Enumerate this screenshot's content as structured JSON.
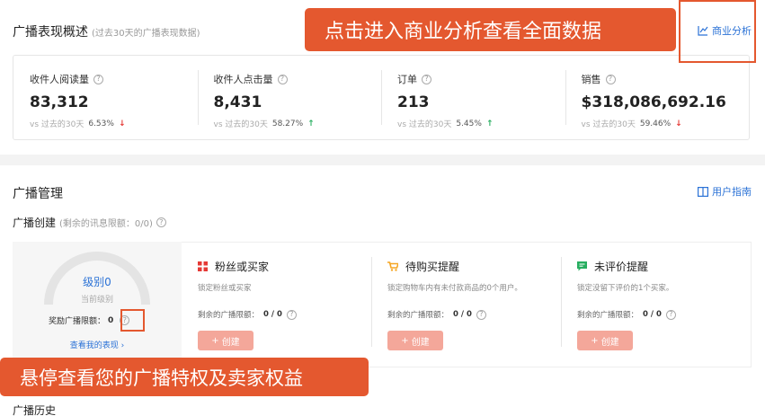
{
  "overview": {
    "title": "广播表现概述",
    "subtitle": "(过去30天的广播表现数据)",
    "business_link": "商业分析",
    "metrics": [
      {
        "label": "收件人阅读量",
        "value": "83,312",
        "compare": "vs 过去的30天",
        "pct": "6.53%",
        "trend": "↓"
      },
      {
        "label": "收件人点击量",
        "value": "8,431",
        "compare": "vs 过去的30天",
        "pct": "58.27%",
        "trend": "↑"
      },
      {
        "label": "订单",
        "value": "213",
        "compare": "vs 过去的30天",
        "pct": "5.45%",
        "trend": "↑"
      },
      {
        "label": "销售",
        "value": "$318,086,692.16",
        "compare": "vs 过去的30天",
        "pct": "59.46%",
        "trend": "↓"
      }
    ]
  },
  "callouts": {
    "top": "点击进入商业分析查看全面数据",
    "bottom": "悬停查看您的广播特权及卖家权益"
  },
  "management": {
    "title": "广播管理",
    "guide_link": "用户指南",
    "create_title": "广播创建",
    "create_sub": "(剩余的讯息限额：0/0)",
    "level": {
      "level_text": "级别0",
      "current_level": "当前级别",
      "reward_label": "奖励广播限额：",
      "reward_value": "0",
      "view_link": "查看我的表现 ›",
      "gauge_fraction": 0
    },
    "options": [
      {
        "title": "粉丝或买家",
        "desc": "锁定粉丝或买家",
        "limit_label": "剩余的广播限额：",
        "limit_value": "0 / 0",
        "button": "创建",
        "icon": "grid-icon",
        "color": "#e53935"
      },
      {
        "title": "待购买提醒",
        "desc": "锁定购物车内有未付款商品的0个用户。",
        "limit_label": "剩余的广播限额：",
        "limit_value": "0 / 0",
        "button": "创建",
        "icon": "cart-icon",
        "color": "#f5a623"
      },
      {
        "title": "未评价提醒",
        "desc": "锁定没留下评价的1个买家。",
        "limit_label": "剩余的广播限额：",
        "limit_value": "0 / 0",
        "button": "创建",
        "icon": "chat-icon",
        "color": "#27ae60"
      }
    ],
    "history_title": "广播历史"
  }
}
